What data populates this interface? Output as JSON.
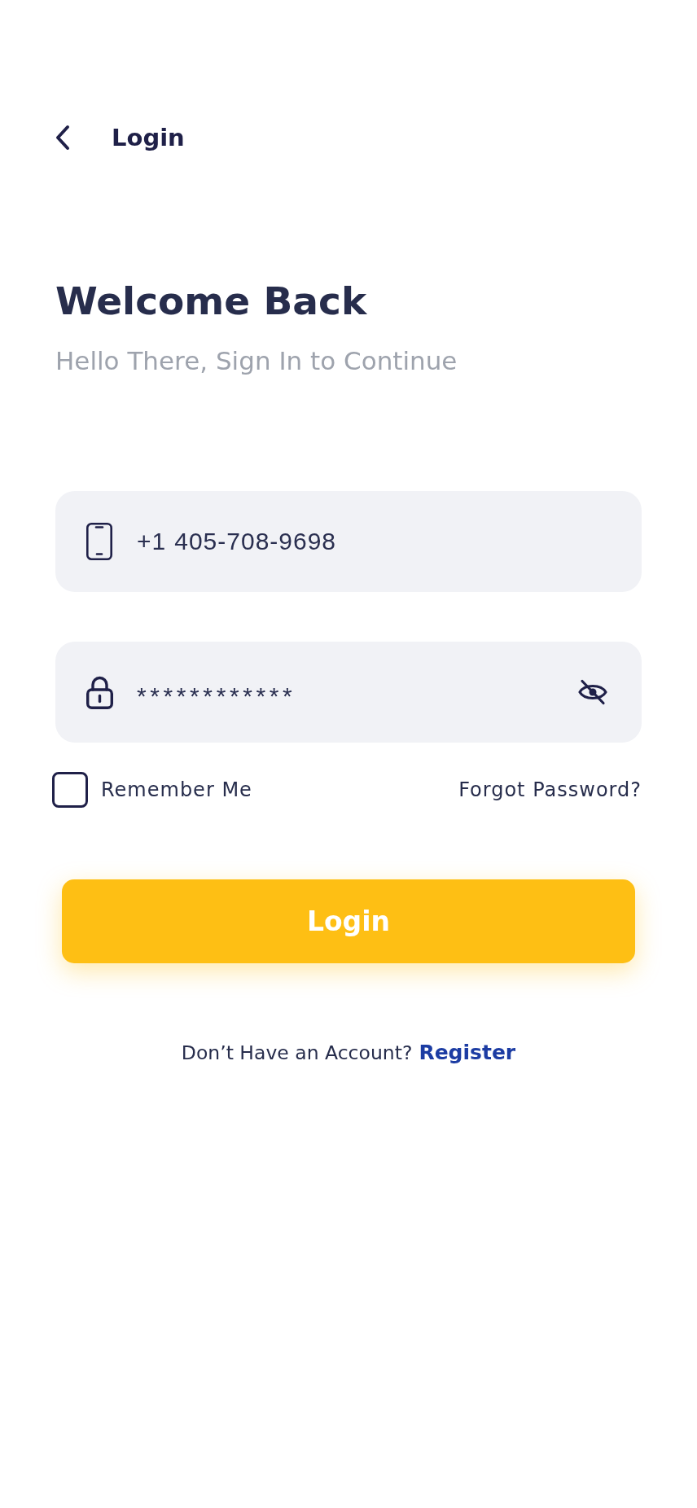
{
  "header": {
    "title": "Login"
  },
  "heading": {
    "title": "Welcome Back",
    "subtitle": "Hello There, Sign In to Continue"
  },
  "fields": [
    {
      "kind": "phone",
      "country_code": "+1",
      "value": "405-708-9698"
    },
    {
      "kind": "password",
      "value": "************",
      "show_password": false
    }
  ],
  "remember_me": {
    "label": "Remember Me",
    "checked": false
  },
  "forgot_password": "Forgot Password?",
  "login_button": "Login",
  "register": {
    "prompt": "Don’t Have an Account?",
    "link": "Register"
  }
}
